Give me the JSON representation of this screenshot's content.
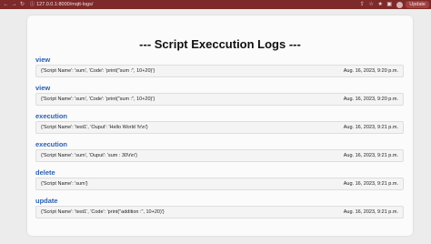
{
  "browser": {
    "url": "127.0.0.1:8000/mqtt-logs/",
    "update_label": "Update"
  },
  "page": {
    "title": "--- Script Execcution Logs ---"
  },
  "logs": [
    {
      "action": "view",
      "details": "{'Script Name': 'sum', 'Code': 'print(\"sum :\", 10+20)'}",
      "timestamp": "Aug. 16, 2023, 9:20 p.m."
    },
    {
      "action": "view",
      "details": "{'Script Name': 'sum', 'Code': 'print(\"sum :\", 10+20)'}",
      "timestamp": "Aug. 16, 2023, 9:20 p.m."
    },
    {
      "action": "execution",
      "details": "{'Script Name': 'test1', 'Ouput': 'Hello World !\\r\\n'}",
      "timestamp": "Aug. 16, 2023, 9:21 p.m."
    },
    {
      "action": "execution",
      "details": "{'Script Name': 'sum', 'Ouput': 'sum : 30\\r\\n'}",
      "timestamp": "Aug. 16, 2023, 9:21 p.m."
    },
    {
      "action": "delete",
      "details": "{'Script Name': 'sum'}",
      "timestamp": "Aug. 16, 2023, 9:21 p.m."
    },
    {
      "action": "update",
      "details": "{'Script Name': 'test1', 'Code': 'print(\"addition :\", 10+20)'}",
      "timestamp": "Aug. 16, 2023, 9:21 p.m."
    }
  ]
}
